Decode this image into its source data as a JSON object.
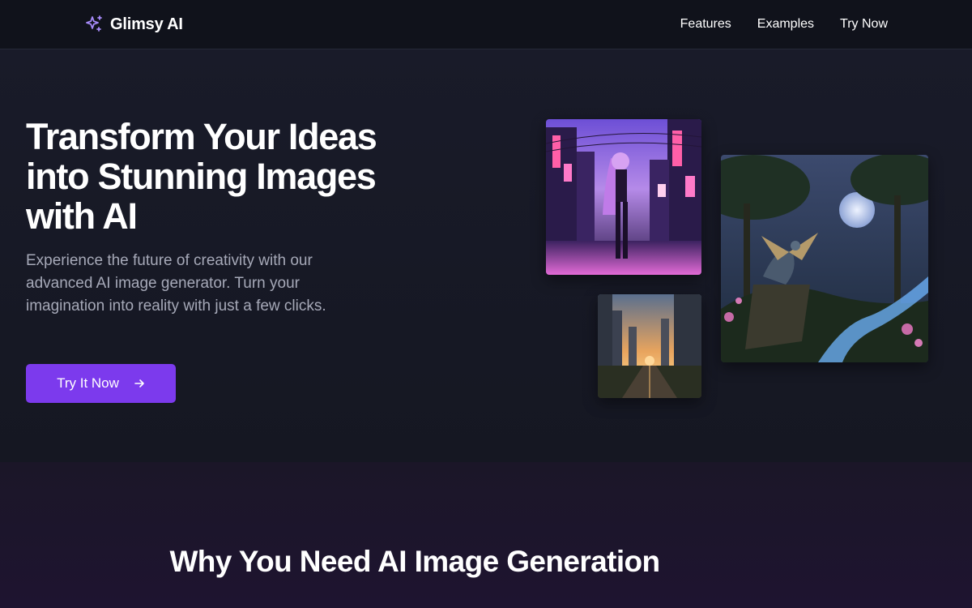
{
  "header": {
    "brand": "Glimsy AI",
    "brand_icon": "sparkles-icon",
    "nav": [
      "Features",
      "Examples",
      "Try Now"
    ]
  },
  "hero": {
    "title": "Transform Your Ideas into Stunning Images with AI",
    "subtitle": "Experience the future of creativity with our advanced AI image generator. Turn your imagination into reality with just a few clicks.",
    "cta_label": "Try It Now",
    "cta_icon": "arrow-right-icon",
    "gallery": [
      {
        "name": "anime-neon-street-image",
        "depicts": "anime girl on neon-lit city street"
      },
      {
        "name": "city-sunset-image",
        "depicts": "city skyline at sunset with highway"
      },
      {
        "name": "dragon-forest-image",
        "depicts": "dragon in moonlit fantasy forest"
      }
    ]
  },
  "section2": {
    "title": "Why You Need AI Image Generation"
  },
  "colors": {
    "background": "#161824",
    "header": "#10121b",
    "accent": "#7c3aed",
    "muted_text": "#a6a9b8",
    "section2_bg": "#1e1430"
  }
}
